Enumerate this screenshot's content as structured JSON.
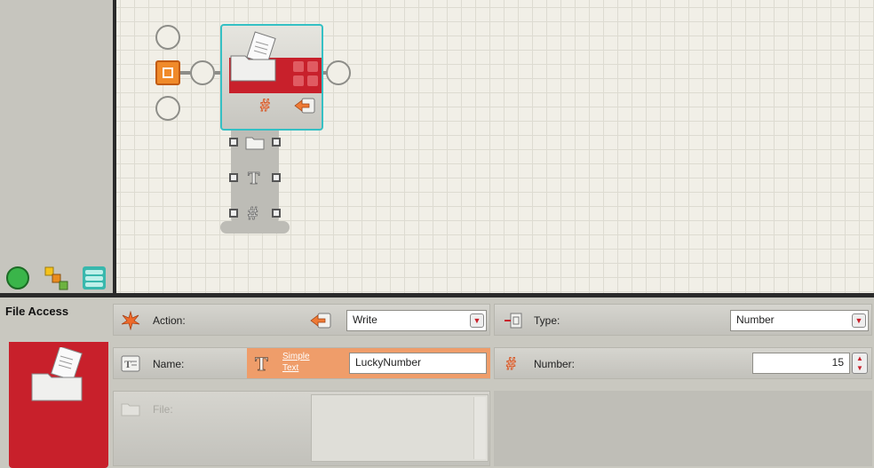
{
  "block": {
    "title": "File Access",
    "icon": "file-access-icon"
  },
  "palette": {
    "tabs": [
      {
        "name": "common-palette-tab",
        "icon": "green-circle-icon"
      },
      {
        "name": "complete-palette-tab",
        "icon": "blocks-icon"
      },
      {
        "name": "custom-palette-tab",
        "icon": "stacked-bars-icon"
      }
    ]
  },
  "config": {
    "action": {
      "label": "Action:",
      "value": "Write"
    },
    "type": {
      "label": "Type:",
      "value": "Number"
    },
    "name": {
      "label": "Name:",
      "mode_line1": "Simple",
      "mode_line2": "Text",
      "value": "LuckyNumber"
    },
    "number": {
      "label": "Number:",
      "value": "15"
    },
    "file": {
      "label": "File:"
    }
  },
  "colors": {
    "accent_red": "#c8202b",
    "selection": "#35c0c4",
    "canvas": "#f1efe7",
    "highlight_orange": "#ef9d6a"
  }
}
